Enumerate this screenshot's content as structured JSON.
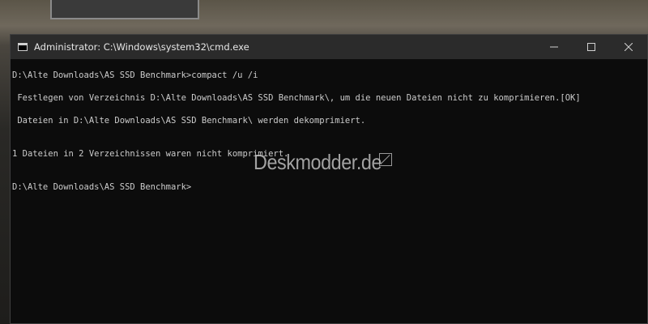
{
  "window": {
    "title": "Administrator: C:\\Windows\\system32\\cmd.exe",
    "minimize_icon": "minimize-icon",
    "maximize_icon": "maximize-icon",
    "close_icon": "close-icon"
  },
  "console": {
    "lines": [
      "D:\\Alte Downloads\\AS SSD Benchmark>compact /u /i",
      " Festlegen von Verzeichnis D:\\Alte Downloads\\AS SSD Benchmark\\, um die neuen Dateien nicht zu komprimieren.[OK]",
      " Dateien in D:\\Alte Downloads\\AS SSD Benchmark\\ werden dekomprimiert.",
      "1 Dateien in 2 Verzeichnissen waren nicht komprimiert.",
      "D:\\Alte Downloads\\AS SSD Benchmark>"
    ]
  },
  "watermark": {
    "text": "Deskmodder.de"
  },
  "colors": {
    "console_bg": "#0c0c0c",
    "console_text": "#cccccc",
    "titlebar_bg": "#2b2b2b"
  }
}
